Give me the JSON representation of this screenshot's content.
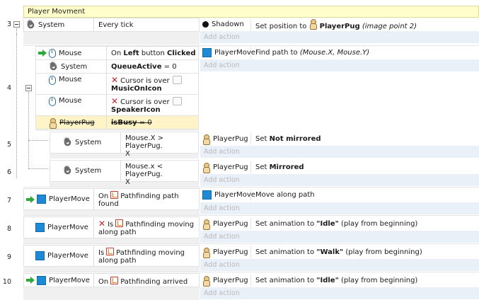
{
  "group": {
    "title": "Player Movment"
  },
  "add_action_label": "Add action",
  "events": [
    {
      "number": "3",
      "conditions": [
        {
          "object": "System",
          "text": "Every tick"
        }
      ],
      "actions": [
        {
          "object": "Shadown",
          "text_plain": "Set position to ",
          "target": "PlayerPug",
          "suffix": "(image point 2)"
        }
      ]
    },
    {
      "number": "4",
      "conditions": [
        {
          "object": "Mouse",
          "prefix": "On ",
          "bold1": "Left",
          "mid": " button ",
          "bold2": "Clicked"
        },
        {
          "object": "System",
          "bold": "QueueActive",
          "rest": " = 0"
        },
        {
          "object": "Mouse",
          "line1": "Cursor is over",
          "line2": "MusicOnIcon"
        },
        {
          "object": "Mouse",
          "line1": "Cursor is over",
          "line2": "SpeakerIcon"
        },
        {
          "object": "PlayerPug",
          "bold": "isBusy",
          "rest": " = 0"
        }
      ],
      "actions": [
        {
          "object": "PlayerMove",
          "text": "Find path to ",
          "args": "(Mouse.X, Mouse.Y)"
        }
      ]
    },
    {
      "number": "5",
      "conditions": [
        {
          "object": "System",
          "line1": "Mouse.X > PlayerPug.",
          "line2": "X"
        }
      ],
      "actions": [
        {
          "object": "PlayerPug",
          "text": "Set ",
          "bold": "Not mirrored"
        }
      ]
    },
    {
      "number": "6",
      "conditions": [
        {
          "object": "System",
          "line1": "Mouse.x < PlayerPug.",
          "line2": "X"
        }
      ],
      "actions": [
        {
          "object": "PlayerPug",
          "text": "Set ",
          "bold": "Mirrored"
        }
      ]
    },
    {
      "number": "7",
      "conditions": [
        {
          "object": "PlayerMove",
          "prefix": "On",
          "line1": "Pathfinding path",
          "line2": "found"
        }
      ],
      "actions": [
        {
          "object": "PlayerMove",
          "text": "Move along path"
        }
      ]
    },
    {
      "number": "8",
      "conditions": [
        {
          "object": "PlayerMove",
          "prefix": "Is",
          "line1": "Pathfinding moving",
          "line2": "along path"
        }
      ],
      "actions": [
        {
          "object": "PlayerPug",
          "text": "Set animation to ",
          "bold": "\"Idle\"",
          "rest": " (play from beginning)"
        }
      ]
    },
    {
      "number": "9",
      "conditions": [
        {
          "object": "PlayerMove",
          "prefix": "Is",
          "line1": "Pathfinding moving",
          "line2": "along path"
        }
      ],
      "actions": [
        {
          "object": "PlayerPug",
          "text": "Set animation to ",
          "bold": "\"Walk\"",
          "rest": " (play from beginning)"
        }
      ]
    },
    {
      "number": "10",
      "conditions": [
        {
          "object": "PlayerMove",
          "prefix": "On",
          "line1": "Pathfinding arrived"
        }
      ],
      "actions": [
        {
          "object": "PlayerPug",
          "text": "Set animation to ",
          "bold": "\"Idle\"",
          "rest": " (play from beginning)"
        }
      ]
    }
  ],
  "colors": {
    "group_header_bg": "#ffffcc",
    "trigger_arrow": "#2ea836",
    "invert_x": "#d7202a",
    "behavior_blue": "#1e8ad6",
    "add_action_text": "#b8b8b8"
  }
}
